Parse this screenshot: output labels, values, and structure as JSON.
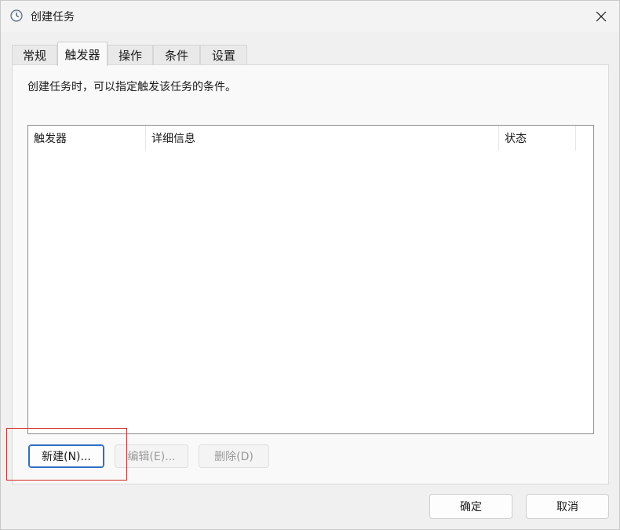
{
  "window": {
    "title": "创建任务",
    "icon": "clock-icon"
  },
  "tabs": [
    {
      "label": "常规",
      "active": false
    },
    {
      "label": "触发器",
      "active": true
    },
    {
      "label": "操作",
      "active": false
    },
    {
      "label": "条件",
      "active": false
    },
    {
      "label": "设置",
      "active": false
    }
  ],
  "panel": {
    "description": "创建任务时，可以指定触发该任务的条件。",
    "list": {
      "columns": [
        "触发器",
        "详细信息",
        "状态"
      ],
      "rows": []
    },
    "buttons": {
      "new": "新建(N)...",
      "edit": "编辑(E)...",
      "delete": "删除(D)"
    }
  },
  "footer": {
    "ok": "确定",
    "cancel": "取消"
  },
  "colors": {
    "highlight": "#d42a2a",
    "primary_border": "#2e6fc6"
  }
}
